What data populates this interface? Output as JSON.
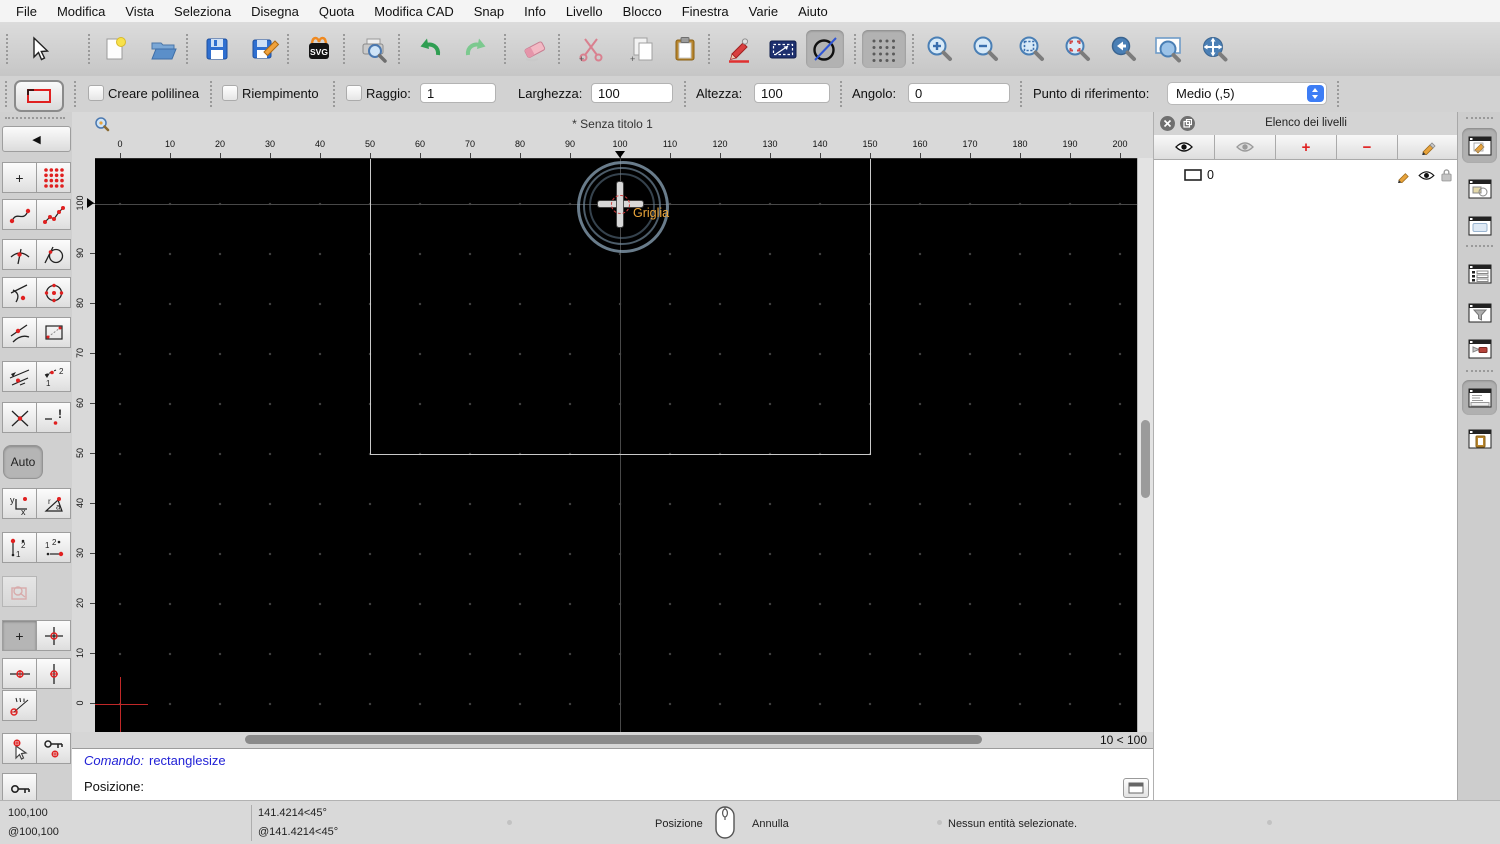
{
  "menu": {
    "items": [
      "File",
      "Modifica",
      "Vista",
      "Seleziona",
      "Disegna",
      "Quota",
      "Modifica CAD",
      "Snap",
      "Info",
      "Livello",
      "Blocco",
      "Finestra",
      "Varie",
      "Aiuto"
    ]
  },
  "options": {
    "creare_polilinea_label": "Creare polilinea",
    "riempimento_label": "Riempimento",
    "raggio_label": "Raggio:",
    "raggio_value": "1",
    "larghezza_label": "Larghezza:",
    "larghezza_value": "100",
    "altezza_label": "Altezza:",
    "altezza_value": "100",
    "angolo_label": "Angolo:",
    "angolo_value": "0",
    "punto_riferimento_label": "Punto di riferimento:",
    "punto_riferimento_value": "Medio (,5)"
  },
  "palette": {
    "back_icon": "◀",
    "snap_free_icon": "+",
    "restrict_off_icon": "+",
    "auto_label": "Auto",
    "glyphs": {
      "one": "1",
      "two": "2",
      "y": "y",
      "x": "x",
      "r": "r",
      "a": "a",
      "excl": "!"
    }
  },
  "document": {
    "title": "* Senza titolo 1",
    "grid_info": "10 < 100",
    "snap_label": "Griglia"
  },
  "rulers": {
    "h": [
      "0",
      "10",
      "20",
      "30",
      "40",
      "50",
      "60",
      "70",
      "80",
      "90",
      "100",
      "110",
      "120",
      "130",
      "140",
      "150",
      "160",
      "170",
      "180",
      "190",
      "200"
    ],
    "v": [
      "100",
      "90",
      "80",
      "70",
      "60",
      "50",
      "40",
      "30",
      "20",
      "10",
      "0"
    ]
  },
  "command_line": {
    "prompt": "Comando:",
    "command": "rectanglesize",
    "position_prompt": "Posizione:"
  },
  "layers_panel": {
    "title": "Elenco dei livelli",
    "add_label": "+",
    "remove_label": "−",
    "layers": [
      {
        "name": "0"
      }
    ]
  },
  "statusbar": {
    "abs_coord": "100,100",
    "rel_coord": "@100,100",
    "abs_polar": "141.4214<45°",
    "rel_polar": "@141.4214<45°",
    "left_click_label": "Posizione",
    "right_click_label": "Annulla",
    "selection_status": "Nessun entità selezionate."
  },
  "colors": {
    "accent_blue": "#3d7df5",
    "command_blue": "#2222d6",
    "snap_orange": "#eda73b",
    "canvas_bg": "#000000",
    "preview_line": "#c9c9c9",
    "origin_red": "#c02828"
  }
}
